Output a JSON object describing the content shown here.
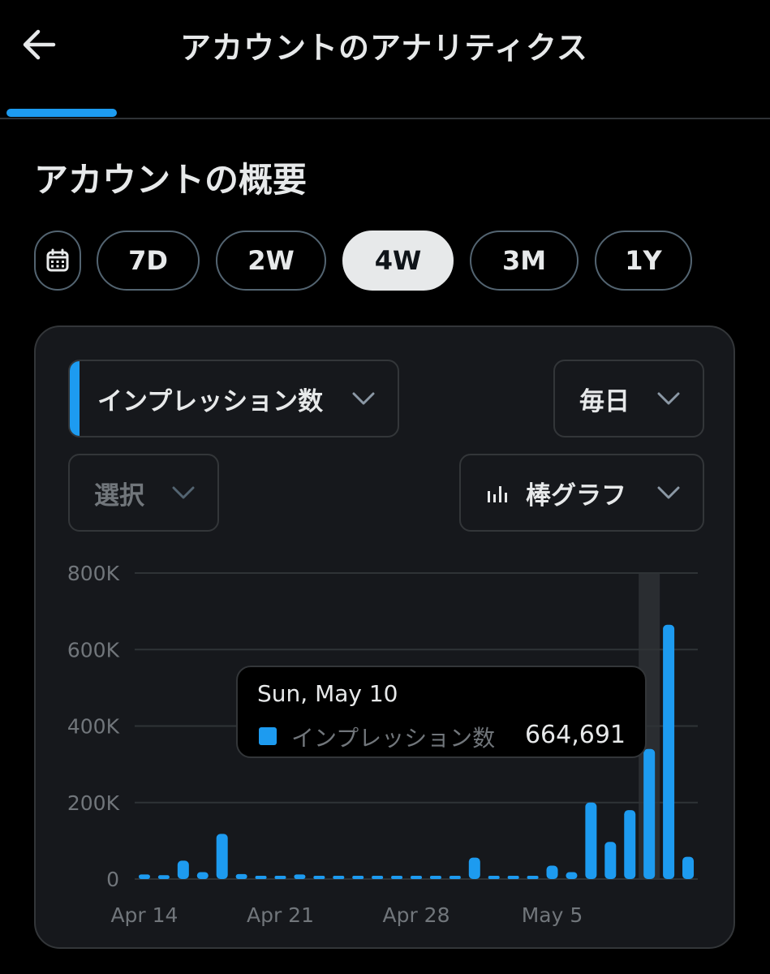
{
  "header": {
    "title": "アカウントのアナリティクス",
    "back_icon": "arrow-left-icon"
  },
  "section": {
    "title": "アカウントの概要"
  },
  "ranges": [
    {
      "label": "7D",
      "active": false
    },
    {
      "label": "2W",
      "active": false
    },
    {
      "label": "4W",
      "active": true
    },
    {
      "label": "3M",
      "active": false
    },
    {
      "label": "1Y",
      "active": false
    }
  ],
  "controls": {
    "metric": "インプレッション数",
    "interval": "毎日",
    "compare": "選択",
    "chart_type": "棒グラフ"
  },
  "tooltip": {
    "date": "Sun, May 10",
    "label": "インプレッション数",
    "value": "664,691"
  },
  "colors": {
    "accent": "#1d9bf0",
    "background": "#000000",
    "card": "#16181c",
    "border": "#333639",
    "muted_text": "#71767b"
  },
  "chart_data": {
    "type": "bar",
    "ylim": [
      0,
      800000
    ],
    "y_ticks": [
      {
        "value": 800000,
        "label": "800K"
      },
      {
        "value": 600000,
        "label": "600K"
      },
      {
        "value": 400000,
        "label": "400K"
      },
      {
        "value": 200000,
        "label": "200K"
      },
      {
        "value": 0,
        "label": "0"
      }
    ],
    "x_labels": [
      {
        "index": 0,
        "label": "Apr 14"
      },
      {
        "index": 7,
        "label": "Apr 21"
      },
      {
        "index": 14,
        "label": "Apr 28"
      },
      {
        "index": 21,
        "label": "May 5"
      }
    ],
    "highlighted_index": 26,
    "series": [
      {
        "name": "インプレッション数",
        "values": [
          12000,
          10000,
          48000,
          18000,
          118000,
          13000,
          6000,
          8000,
          12000,
          6000,
          5000,
          5000,
          5000,
          5000,
          5000,
          5000,
          6000,
          56000,
          6000,
          5000,
          5000,
          35000,
          18000,
          200000,
          97000,
          180000,
          340000,
          664691,
          58000
        ]
      }
    ]
  }
}
